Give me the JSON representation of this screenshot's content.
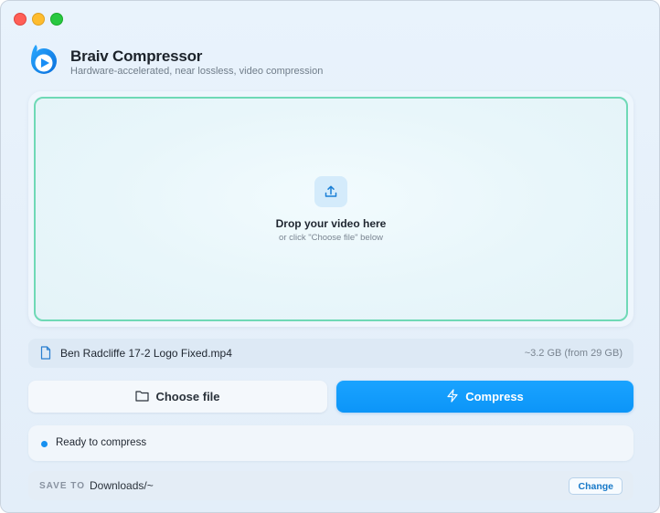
{
  "window": {
    "controls": [
      "close",
      "minimize",
      "maximize"
    ]
  },
  "header": {
    "title": "Braiv Compressor",
    "subtitle": "Hardware-accelerated, near lossless, video compression",
    "logo_icon": "braiv-play-logo-icon"
  },
  "drop_zone": {
    "icon": "upload-icon",
    "title": "Drop your video here",
    "hint": "or click \"Choose file\" below"
  },
  "file": {
    "icon": "document-icon",
    "name": "Ben Radcliffe 17-2 Logo Fixed.mp4",
    "size_estimate": "~3.2 GB (from 29 GB)"
  },
  "actions": {
    "choose_label": "Choose file",
    "choose_icon": "folder-icon",
    "compress_label": "Compress",
    "compress_icon": "lightning-icon"
  },
  "status": {
    "text": "Ready to compress"
  },
  "save": {
    "label": "SAVE TO",
    "path": "Downloads/~",
    "change_label": "Change"
  },
  "colors": {
    "accent": "#0c95f8",
    "drop_border": "#6fd9b6",
    "status_dot": "#1690f0"
  }
}
